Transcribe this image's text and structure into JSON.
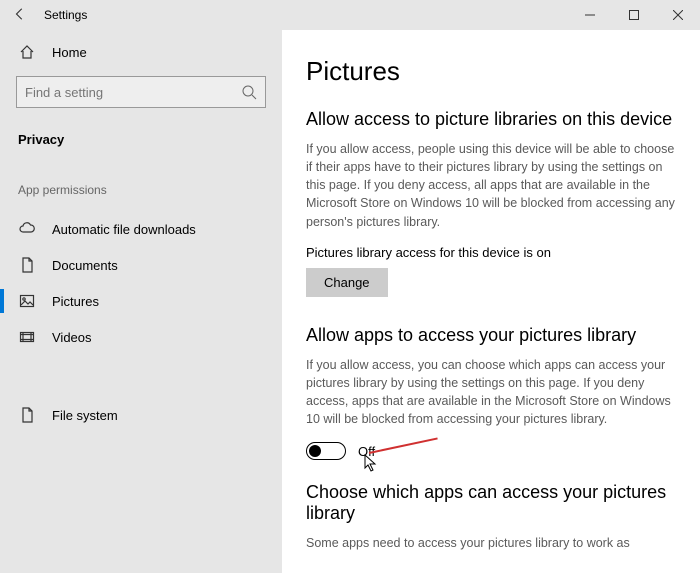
{
  "titlebar": {
    "title": "Settings"
  },
  "sidebar": {
    "home": "Home",
    "search_placeholder": "Find a setting",
    "section": "Privacy",
    "group": "App permissions",
    "items": [
      "Automatic file downloads",
      "Documents",
      "Pictures",
      "Videos",
      "File system"
    ]
  },
  "content": {
    "heading": "Pictures",
    "sec1": {
      "title": "Allow access to picture libraries on this device",
      "desc": "If you allow access, people using this device will be able to choose if their apps have to their pictures library by using the settings on this page. If you deny access, all apps that are available in the Microsoft Store on Windows 10 will be blocked from accessing any person's pictures library.",
      "status": "Pictures library access for this device is on",
      "button": "Change"
    },
    "sec2": {
      "title": "Allow apps to access your pictures library",
      "desc": "If you allow access, you can choose which apps can access your pictures library by using the settings on this page. If you deny access, apps that are available in the Microsoft Store on Windows 10 will be blocked from accessing your pictures library.",
      "toggle_label": "Off"
    },
    "sec3": {
      "title": "Choose which apps can access your pictures library",
      "desc": "Some apps need to access your pictures library to work as"
    }
  }
}
